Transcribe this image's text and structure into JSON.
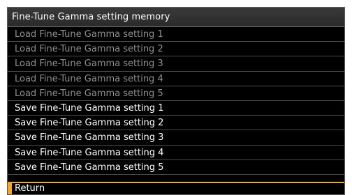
{
  "window": {
    "title": "Fine-Tune Gamma setting memory"
  },
  "menu": {
    "items": [
      {
        "label": "Load Fine-Tune Gamma setting 1",
        "enabled": false
      },
      {
        "label": "Load Fine-Tune Gamma setting 2",
        "enabled": false
      },
      {
        "label": "Load Fine-Tune Gamma setting 3",
        "enabled": false
      },
      {
        "label": "Load Fine-Tune Gamma setting 4",
        "enabled": false
      },
      {
        "label": "Load Fine-Tune Gamma setting 5",
        "enabled": false
      },
      {
        "label": "Save Fine-Tune Gamma setting 1",
        "enabled": true
      },
      {
        "label": "Save Fine-Tune Gamma setting 2",
        "enabled": true
      },
      {
        "label": "Save Fine-Tune Gamma setting 3",
        "enabled": true
      },
      {
        "label": "Save Fine-Tune Gamma setting 4",
        "enabled": true
      },
      {
        "label": "Save Fine-Tune Gamma setting 5",
        "enabled": true
      }
    ],
    "return_label": "Return"
  },
  "colors": {
    "background": "#000000",
    "text_enabled": "#ffffff",
    "text_disabled": "#8f8f8f",
    "accent_selected": "#f5a623"
  }
}
